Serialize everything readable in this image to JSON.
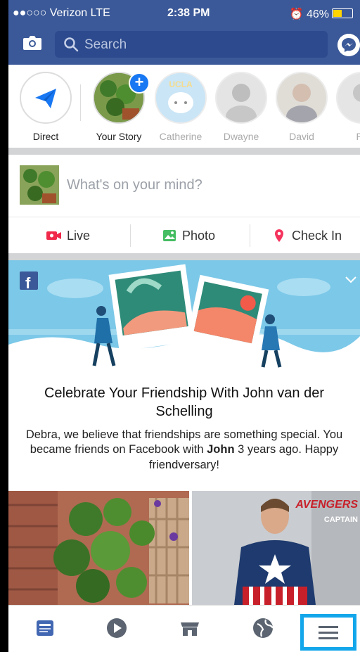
{
  "status_bar": {
    "carrier": "●●○○○ Verizon  LTE",
    "time": "2:38 PM",
    "battery": "46%"
  },
  "header": {
    "search_placeholder": "Search",
    "icons": [
      "camera-icon",
      "search-icon",
      "messenger-icon"
    ],
    "color": "#3b5998"
  },
  "stories": [
    {
      "label": "Direct"
    },
    {
      "label": "Your Story"
    },
    {
      "label": "Catherine"
    },
    {
      "label": "Dwayne"
    },
    {
      "label": "David"
    },
    {
      "label": "Pa"
    }
  ],
  "composer": {
    "placeholder": "What's on your mind?"
  },
  "actions": [
    {
      "label": "Live",
      "icon": "live-video-icon",
      "color": "#f02849"
    },
    {
      "label": "Photo",
      "icon": "photo-icon",
      "color": "#45bd62"
    },
    {
      "label": "Check In",
      "icon": "location-pin-icon",
      "color": "#f5533d"
    }
  ],
  "friendversary": {
    "title": "Celebrate Your Friendship With John van der Schelling",
    "body_before": "Debra, we believe that friendships are something special. You became friends on Facebook with ",
    "body_bold": "John",
    "body_after": " 3 years ago. Happy friendversary!"
  },
  "photo_preview": {
    "poster_text_top": "AVENGERS",
    "poster_text_bottom": "CAPTAIN"
  },
  "tabs": [
    {
      "name": "news-feed",
      "icon": "news-feed-icon"
    },
    {
      "name": "watch",
      "icon": "video-play-icon"
    },
    {
      "name": "marketplace",
      "icon": "marketplace-icon"
    },
    {
      "name": "notifications",
      "icon": "globe-icon"
    },
    {
      "name": "menu",
      "icon": "hamburger-menu-icon"
    }
  ]
}
